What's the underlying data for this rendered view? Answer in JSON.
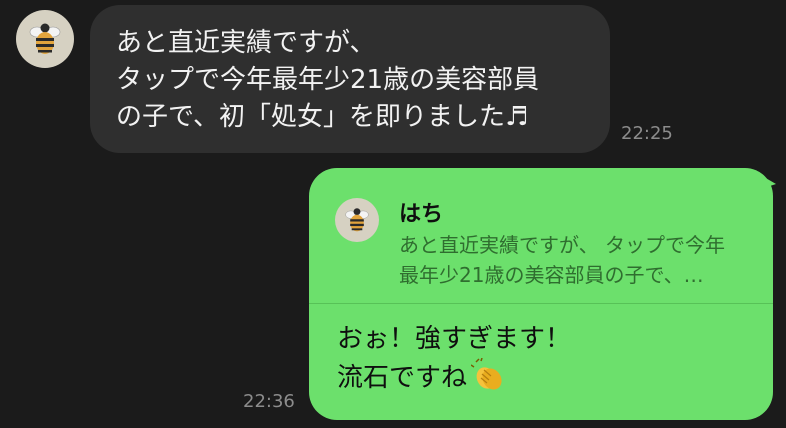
{
  "incoming": {
    "lines": [
      "あと直近実績ですが、",
      "タップで今年最年少21歳の美容部員",
      "の子で、初「処女」を即りました♬"
    ],
    "time": "22:25",
    "avatar_icon": "bee-icon"
  },
  "outgoing": {
    "quote": {
      "sender": "はち",
      "lines": [
        "あと直近実績ですが、 タップで今年",
        "最年少21歳の美容部員の子で、…"
      ],
      "avatar_icon": "bee-icon"
    },
    "lines": [
      "おぉ！強すぎます！",
      "流石ですね"
    ],
    "emoji_icon": "clapping-hands-icon",
    "time": "22:36"
  },
  "colors": {
    "background": "#1b1b1b",
    "incoming_bubble": "#2f2f2f",
    "outgoing_bubble": "#6ce06c",
    "timestamp": "#8c8c8c"
  }
}
